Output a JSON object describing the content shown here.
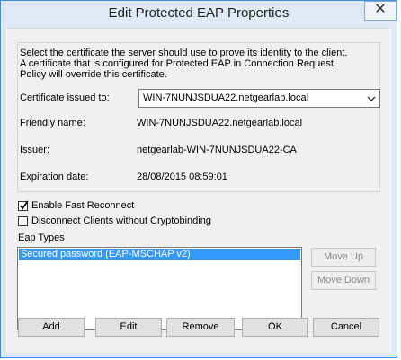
{
  "dialog": {
    "title": "Edit Protected EAP Properties",
    "close_glyph": "✕"
  },
  "description": {
    "line1": "Select the certificate the server should use to prove its identity to the client.",
    "line2": "A certificate that is configured for Protected EAP in Connection Request",
    "line3": "Policy will override this certificate."
  },
  "certificate": {
    "issued_to_label": "Certificate issued to:",
    "issued_to_value": "WIN-7NUNJSDUA22.netgearlab.local",
    "friendly_name_label": "Friendly name:",
    "friendly_name_value": "WIN-7NUNJSDUA22.netgearlab.local",
    "issuer_label": "Issuer:",
    "issuer_value": "netgearlab-WIN-7NUNJSDUA22-CA",
    "expiration_label": "Expiration date:",
    "expiration_value": "28/08/2015 08:59:01"
  },
  "options": {
    "fast_reconnect_label": "Enable Fast Reconnect",
    "fast_reconnect_checked": true,
    "disconnect_label": "Disconnect Clients without Cryptobinding",
    "disconnect_checked": false
  },
  "eap_types": {
    "label": "Eap Types",
    "items": [
      "Secured password (EAP-MSCHAP v2)"
    ],
    "selected_index": 0
  },
  "buttons": {
    "move_up": "Move Up",
    "move_down": "Move Down",
    "add": "Add",
    "edit": "Edit",
    "remove": "Remove",
    "ok": "OK",
    "cancel": "Cancel"
  },
  "colors": {
    "accent_border": "#3f8fe0",
    "selection": "#3399ff"
  }
}
